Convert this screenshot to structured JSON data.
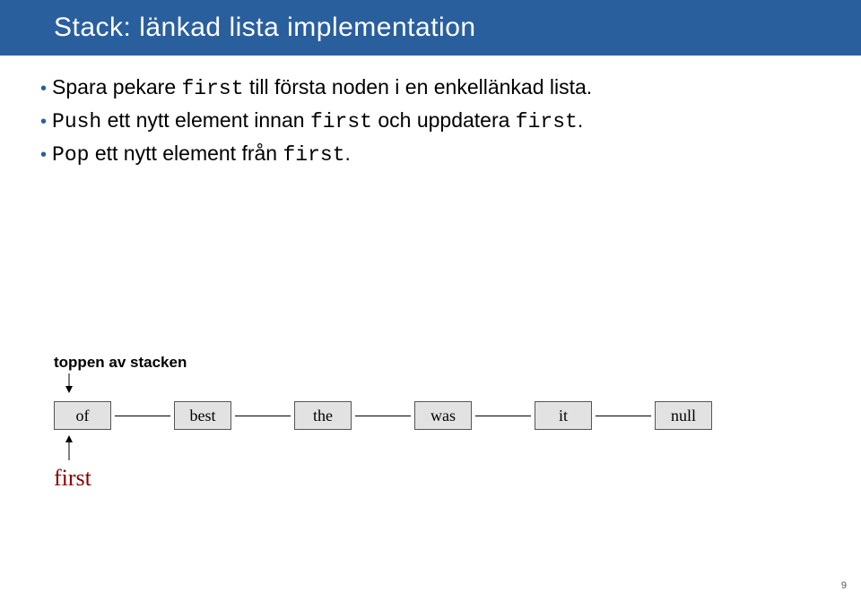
{
  "title": "Stack:  länkad lista implementation",
  "bullets": [
    {
      "pre": "Spara pekare ",
      "code": "first",
      "post": " till första noden i en enkellänkad lista."
    },
    {
      "precode": "Push",
      "post": " ett nytt element innan ",
      "code2": "first",
      "post2": " och uppdatera ",
      "code3": "first",
      "post3": "."
    },
    {
      "precode": "Pop",
      "post": " ett nytt element från ",
      "code2": "first",
      "post2": "."
    }
  ],
  "diagram": {
    "caption": "toppen av stacken",
    "nodes": [
      "of",
      "best",
      "the",
      "was",
      "it",
      "null"
    ],
    "first_label": "first"
  },
  "page_number": "9"
}
